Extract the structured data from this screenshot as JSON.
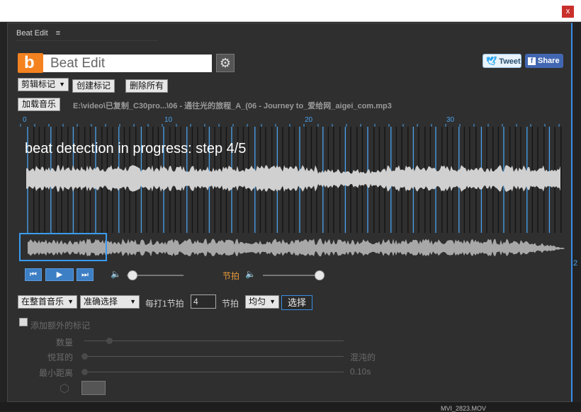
{
  "window": {
    "close_label": "x"
  },
  "panel": {
    "tab_title": "Beat Edit",
    "menu_icon": "≡"
  },
  "header": {
    "logo_letter": "b",
    "title": "Beat Edit",
    "gear_icon": "⚙",
    "tweet_label": "Tweet",
    "share_label": "Share"
  },
  "toolbar": {
    "marker_type_select": "剪辑标记",
    "create_markers": "创建标记",
    "delete_all": "删除所有",
    "load_music": "加载音乐",
    "file_path": "E:\\video\\已复制_C30pro...\\06 - 通往光的旅程_A_(06 - Journey to_爱给网_aigei_com.mp3"
  },
  "timeline": {
    "ticks": [
      "0",
      "10",
      "20",
      "30"
    ],
    "status": "beat detection in progress: step 4/5"
  },
  "transport": {
    "prev_icon": "⏮",
    "play_icon": "▶",
    "next_icon": "⏭",
    "music_volume": 0.1,
    "beat_label": "节拍",
    "beat_volume": 1.0,
    "volume_icon": "🔈"
  },
  "selection": {
    "scope_select": "在整首音乐",
    "mode_select": "准确选择",
    "every_label": "每打1节拍",
    "every_value": "4",
    "beat_unit": "节拍",
    "distribution_select": "均匀",
    "select_button": "选择"
  },
  "extra": {
    "add_extra_markers": "添加额外的标记",
    "quantity_label": "数量",
    "pleasant_label": "悦耳的",
    "chaotic_label": "混沌的",
    "min_distance_label": "最小距离",
    "min_distance_value": "0.10s"
  },
  "background": {
    "edge_text": "2",
    "item_text": "MVI_2823.MOV"
  },
  "colors": {
    "accent": "#3a8ee6",
    "orange": "#f58220",
    "beat_label": "#e89a3c"
  }
}
